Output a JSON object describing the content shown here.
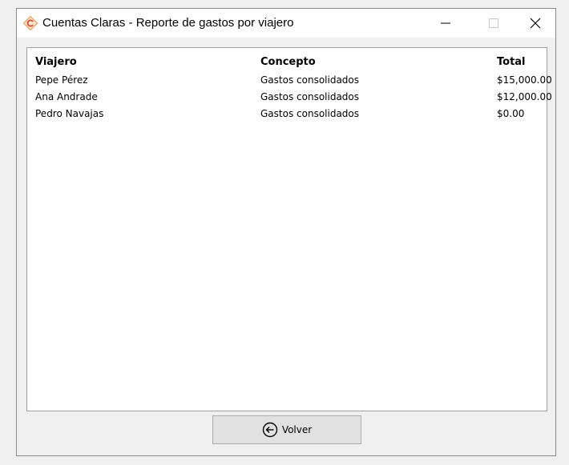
{
  "window": {
    "title": "Cuentas Claras - Reporte de gastos por viajero",
    "icon": "cuentas-claras-logo"
  },
  "table": {
    "headers": [
      "Viajero",
      "Concepto",
      "Total"
    ],
    "rows": [
      [
        "Pepe Pérez",
        "Gastos consolidados",
        "$15,000.00"
      ],
      [
        "Ana Andrade",
        "Gastos consolidados",
        "$12,000.00"
      ],
      [
        "Pedro Navajas",
        "Gastos consolidados",
        "$0.00"
      ]
    ]
  },
  "footer": {
    "back_label": "Volver",
    "back_icon": "arrow-left-circle-icon"
  },
  "colors": {
    "logo_orange": "#e8a15f",
    "logo_red": "#d24a3b"
  }
}
